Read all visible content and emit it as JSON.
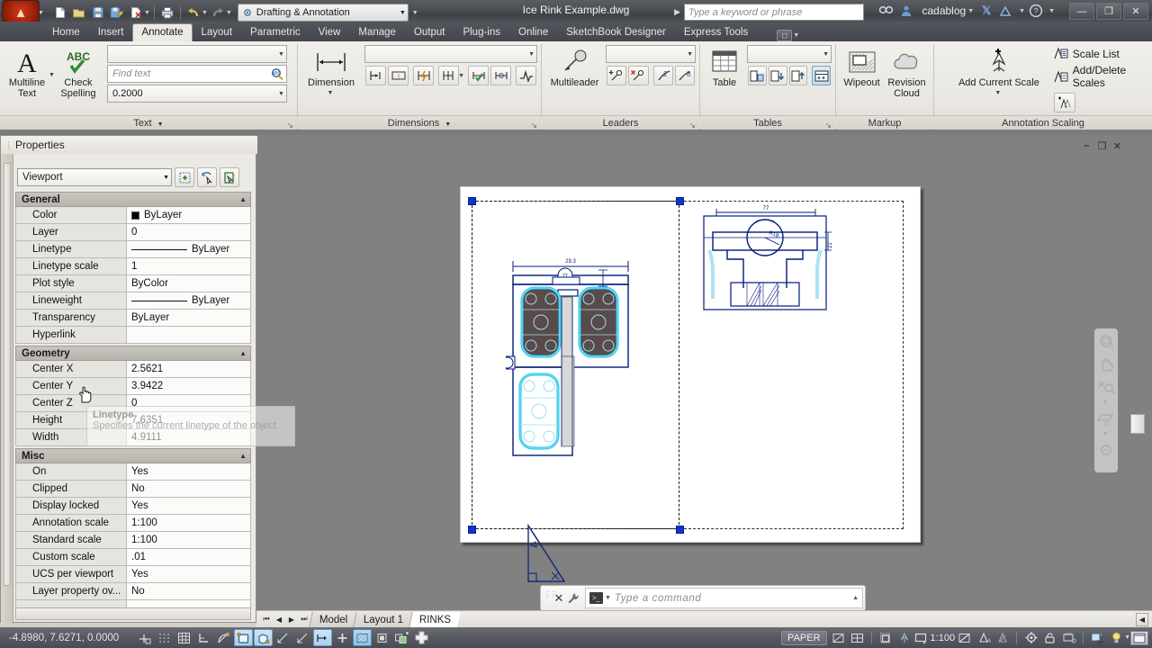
{
  "app": {
    "title": "Ice Rink Example.dwg",
    "workspace": "Drafting & Annotation",
    "user": "cadablog",
    "search_placeholder": "Type a keyword or phrase"
  },
  "quick_access": {
    "items": [
      {
        "name": "new",
        "glyph": "⬜"
      },
      {
        "name": "open",
        "glyph": "📂"
      },
      {
        "name": "save",
        "glyph": "💾"
      },
      {
        "name": "save-as",
        "glyph": "🖫"
      },
      {
        "name": "plot-preview",
        "glyph": "🖊"
      },
      {
        "name": "plot",
        "glyph": "🖨"
      },
      {
        "name": "undo",
        "glyph": "↶"
      },
      {
        "name": "redo",
        "glyph": "↷"
      }
    ]
  },
  "window_buttons": {
    "minimize": "—",
    "restore": "❐",
    "close": "✕"
  },
  "ribbon": {
    "tabs": [
      {
        "label": "Home",
        "active": false
      },
      {
        "label": "Insert",
        "active": false
      },
      {
        "label": "Annotate",
        "active": true
      },
      {
        "label": "Layout",
        "active": false
      },
      {
        "label": "Parametric",
        "active": false
      },
      {
        "label": "View",
        "active": false
      },
      {
        "label": "Manage",
        "active": false
      },
      {
        "label": "Output",
        "active": false
      },
      {
        "label": "Plug-ins",
        "active": false
      },
      {
        "label": "Online",
        "active": false
      },
      {
        "label": "SketchBook Designer",
        "active": false
      },
      {
        "label": "Express Tools",
        "active": false
      }
    ],
    "panels": [
      {
        "title": "Text",
        "big_button": {
          "line1": "Multiline",
          "line2": "Text"
        },
        "second_button": {
          "line1": "Check",
          "line2": "Spelling"
        },
        "style_combo_value": "",
        "find_placeholder": "Find text",
        "height_value": "0.2000"
      },
      {
        "title": "Dimensions",
        "big_button": {
          "line1": "Dimension",
          "line2": ""
        },
        "style_combo_value": ""
      },
      {
        "title": "Leaders",
        "big_button": {
          "line1": "Multileader",
          "line2": ""
        },
        "style_combo_value": ""
      },
      {
        "title": "Tables",
        "big_button": {
          "line1": "Table",
          "line2": ""
        },
        "style_combo_value": ""
      },
      {
        "title": "Markup",
        "buttons": [
          {
            "line1": "Wipeout",
            "line2": ""
          },
          {
            "line1": "Revision",
            "line2": "Cloud"
          }
        ]
      },
      {
        "title": "Annotation Scaling",
        "big_button": {
          "line1": "Add Current Scale",
          "line2": ""
        },
        "links": [
          "Scale List",
          "Add/Delete Scales"
        ]
      }
    ]
  },
  "properties": {
    "title": "Properties",
    "object_type": "Viewport",
    "groups": [
      {
        "name": "General",
        "rows": [
          {
            "name": "Color",
            "value": "ByLayer",
            "kind": "color"
          },
          {
            "name": "Layer",
            "value": "0",
            "kind": "text"
          },
          {
            "name": "Linetype",
            "value": "ByLayer",
            "kind": "linetype"
          },
          {
            "name": "Linetype scale",
            "value": "1",
            "kind": "text"
          },
          {
            "name": "Plot style",
            "value": "ByColor",
            "kind": "text"
          },
          {
            "name": "Lineweight",
            "value": "ByLayer",
            "kind": "linetype"
          },
          {
            "name": "Transparency",
            "value": "ByLayer",
            "kind": "text"
          },
          {
            "name": "Hyperlink",
            "value": "",
            "kind": "text"
          }
        ]
      },
      {
        "name": "Geometry",
        "rows": [
          {
            "name": "Center X",
            "value": "2.5621",
            "kind": "text"
          },
          {
            "name": "Center Y",
            "value": "3.9422",
            "kind": "text"
          },
          {
            "name": "Center Z",
            "value": "0",
            "kind": "text"
          },
          {
            "name": "Height",
            "value": "7.6351",
            "kind": "text"
          },
          {
            "name": "Width",
            "value": "4.9111",
            "kind": "text"
          }
        ]
      },
      {
        "name": "Misc",
        "rows": [
          {
            "name": "On",
            "value": "Yes",
            "kind": "text"
          },
          {
            "name": "Clipped",
            "value": "No",
            "kind": "text"
          },
          {
            "name": "Display locked",
            "value": "Yes",
            "kind": "text"
          },
          {
            "name": "Annotation scale",
            "value": "1:100",
            "kind": "text"
          },
          {
            "name": "Standard scale",
            "value": "1:100",
            "kind": "text"
          },
          {
            "name": "Custom scale",
            "value": ".01",
            "kind": "text"
          },
          {
            "name": "UCS per viewport",
            "value": "Yes",
            "kind": "text"
          },
          {
            "name": "Layer property ov...",
            "value": "No",
            "kind": "text"
          }
        ]
      }
    ],
    "tooltip": {
      "title": "Linetype",
      "body": "Specifies the current linetype of the object"
    }
  },
  "drawing": {
    "dim_top_left": "29.3",
    "dim_top_right": "77",
    "dim_radius": "R18",
    "dim_side": "21'",
    "label_tt": "TT"
  },
  "command_line": {
    "placeholder": "Type a command"
  },
  "layout_tabs": {
    "items": [
      {
        "label": "Model",
        "active": false
      },
      {
        "label": "Layout 1",
        "active": false
      },
      {
        "label": "RINKS",
        "active": true
      }
    ]
  },
  "status_bar": {
    "coordinates": "-4.8980, 7.6271, 0.0000",
    "space_mode": "PAPER",
    "annotation_scale": "1:100",
    "toggles": [
      {
        "name": "infer-constraints",
        "on": false
      },
      {
        "name": "snap-mode",
        "on": false
      },
      {
        "name": "grid-display",
        "on": false
      },
      {
        "name": "ortho-mode",
        "on": false
      },
      {
        "name": "polar-tracking",
        "on": false
      },
      {
        "name": "object-snap",
        "on": true
      },
      {
        "name": "3d-object-snap",
        "on": true
      },
      {
        "name": "object-snap-tracking",
        "on": false
      },
      {
        "name": "dynamic-ucs",
        "on": false
      },
      {
        "name": "dynamic-input",
        "on": false
      },
      {
        "name": "show-lineweight",
        "on": false
      },
      {
        "name": "transparency",
        "on": true
      },
      {
        "name": "quick-properties",
        "on": false
      },
      {
        "name": "selection-cycling",
        "on": false
      },
      {
        "name": "annotation-monitor",
        "on": false
      }
    ]
  }
}
